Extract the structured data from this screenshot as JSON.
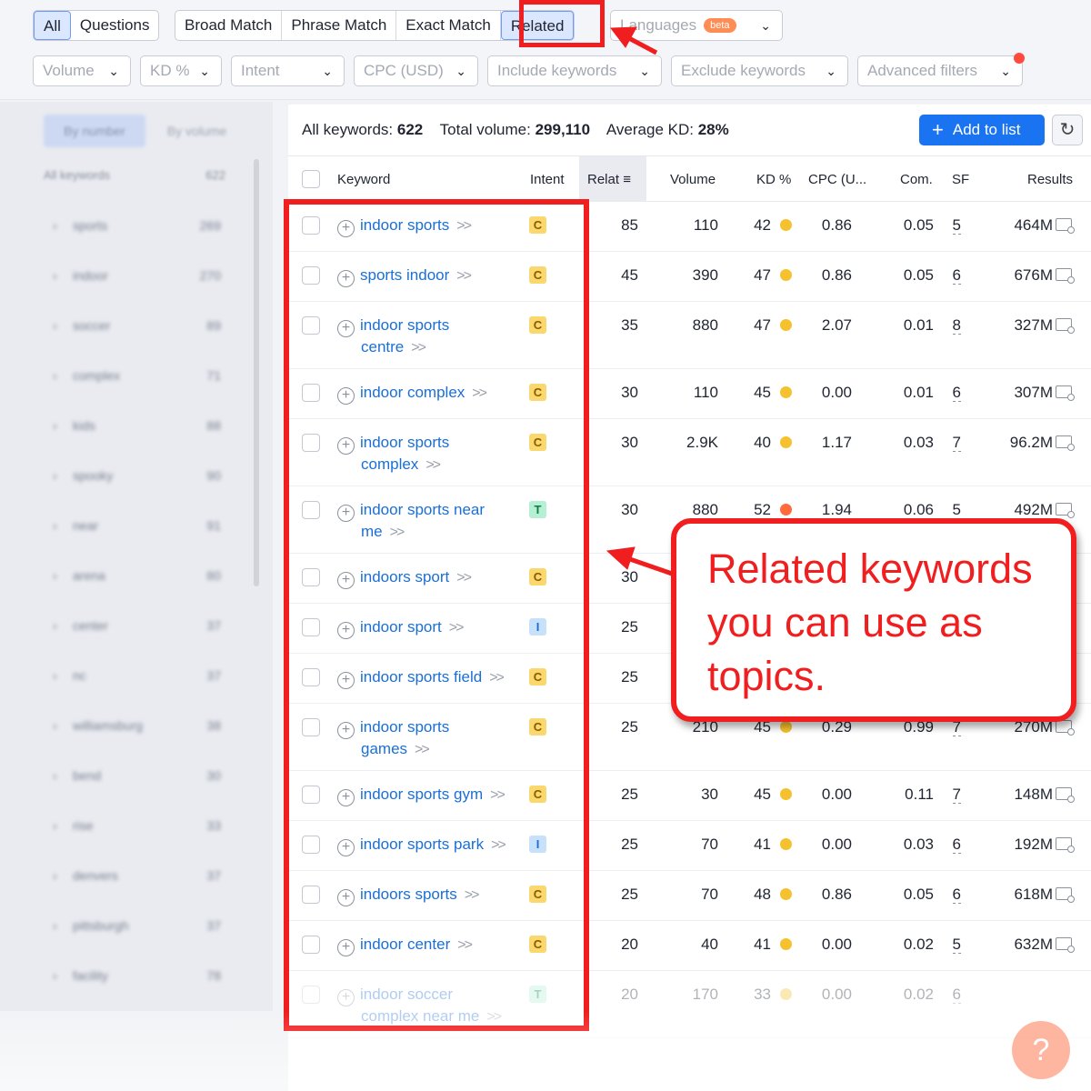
{
  "tabs": {
    "type_group": [
      "All",
      "Questions"
    ],
    "match_group": [
      "Broad Match",
      "Phrase Match",
      "Exact Match",
      "Related"
    ],
    "active_type": "All",
    "active_match": "Related"
  },
  "languages": {
    "label": "Languages",
    "badge": "beta"
  },
  "filters": [
    {
      "label": "Volume"
    },
    {
      "label": "KD %"
    },
    {
      "label": "Intent"
    },
    {
      "label": "CPC (USD)"
    },
    {
      "label": "Include keywords"
    },
    {
      "label": "Exclude keywords"
    },
    {
      "label": "Advanced filters"
    }
  ],
  "stats": {
    "all_keywords_label": "All keywords:",
    "all_keywords_value": "622",
    "total_volume_label": "Total volume:",
    "total_volume_value": "299,110",
    "avg_kd_label": "Average KD:",
    "avg_kd_value": "28%"
  },
  "actions": {
    "add_to_list": "Add to list"
  },
  "columns": {
    "keyword": "Keyword",
    "intent": "Intent",
    "related": "Relat",
    "volume": "Volume",
    "kd": "KD %",
    "cpc": "CPC (U...",
    "com": "Com.",
    "sf": "SF",
    "results": "Results"
  },
  "rows": [
    {
      "kw1": "indoor sports",
      "kw2": "",
      "intent": "C",
      "rel": "85",
      "vol": "110",
      "kd": "42",
      "kd_color": "#f5c12e",
      "cpc": "0.86",
      "com": "0.05",
      "sf": "5",
      "results": "464M"
    },
    {
      "kw1": "sports indoor",
      "kw2": "",
      "intent": "C",
      "rel": "45",
      "vol": "390",
      "kd": "47",
      "kd_color": "#f5c12e",
      "cpc": "0.86",
      "com": "0.05",
      "sf": "6",
      "results": "676M"
    },
    {
      "kw1": "indoor sports",
      "kw2": "centre",
      "intent": "C",
      "rel": "35",
      "vol": "880",
      "kd": "47",
      "kd_color": "#f5c12e",
      "cpc": "2.07",
      "com": "0.01",
      "sf": "8",
      "results": "327M"
    },
    {
      "kw1": "indoor complex",
      "kw2": "",
      "intent": "C",
      "rel": "30",
      "vol": "110",
      "kd": "45",
      "kd_color": "#f5c12e",
      "cpc": "0.00",
      "com": "0.01",
      "sf": "6",
      "results": "307M"
    },
    {
      "kw1": "indoor sports",
      "kw2": "complex",
      "intent": "C",
      "rel": "30",
      "vol": "2.9K",
      "kd": "40",
      "kd_color": "#f5c12e",
      "cpc": "1.17",
      "com": "0.03",
      "sf": "7",
      "results": "96.2M"
    },
    {
      "kw1": "indoor sports near",
      "kw2": "me",
      "intent": "T",
      "rel": "30",
      "vol": "880",
      "kd": "52",
      "kd_color": "#ff6b3d",
      "cpc": "1.94",
      "com": "0.06",
      "sf": "5",
      "results": "492M"
    },
    {
      "kw1": "indoors sport",
      "kw2": "",
      "intent": "C",
      "rel": "30",
      "vol": "",
      "kd": "",
      "kd_color": "",
      "cpc": "",
      "com": "",
      "sf": "",
      "results": ""
    },
    {
      "kw1": "indoor sport",
      "kw2": "",
      "intent": "I",
      "rel": "25",
      "vol": "",
      "kd": "",
      "kd_color": "",
      "cpc": "",
      "com": "",
      "sf": "",
      "results": ""
    },
    {
      "kw1": "indoor sports field",
      "kw2": "",
      "intent": "C",
      "rel": "25",
      "vol": "",
      "kd": "",
      "kd_color": "",
      "cpc": "",
      "com": "",
      "sf": "",
      "results": ""
    },
    {
      "kw1": "indoor sports",
      "kw2": "games",
      "intent": "C",
      "rel": "25",
      "vol": "210",
      "kd": "45",
      "kd_color": "#f5c12e",
      "cpc": "0.29",
      "com": "0.99",
      "sf": "7",
      "results": "270M"
    },
    {
      "kw1": "indoor sports gym",
      "kw2": "",
      "intent": "C",
      "rel": "25",
      "vol": "30",
      "kd": "45",
      "kd_color": "#f5c12e",
      "cpc": "0.00",
      "com": "0.11",
      "sf": "7",
      "results": "148M"
    },
    {
      "kw1": "indoor sports park",
      "kw2": "",
      "intent": "I",
      "rel": "25",
      "vol": "70",
      "kd": "41",
      "kd_color": "#f5c12e",
      "cpc": "0.00",
      "com": "0.03",
      "sf": "6",
      "results": "192M"
    },
    {
      "kw1": "indoors sports",
      "kw2": "",
      "intent": "C",
      "rel": "25",
      "vol": "70",
      "kd": "48",
      "kd_color": "#f5c12e",
      "cpc": "0.86",
      "com": "0.05",
      "sf": "6",
      "results": "618M"
    },
    {
      "kw1": "indoor center",
      "kw2": "",
      "intent": "C",
      "rel": "20",
      "vol": "40",
      "kd": "41",
      "kd_color": "#f5c12e",
      "cpc": "0.00",
      "com": "0.02",
      "sf": "5",
      "results": "632M"
    },
    {
      "kw1": "indoor soccer",
      "kw2": "complex near me",
      "intent": "T",
      "rel": "20",
      "vol": "170",
      "kd": "33",
      "kd_color": "#f5c12e",
      "cpc": "0.00",
      "com": "0.02",
      "sf": "6",
      "results": ""
    }
  ],
  "callout": {
    "text": "Related keywords you can use as topics."
  },
  "help": {
    "label": "?"
  },
  "sidebar": {
    "toggle": [
      "By number",
      "By volume"
    ],
    "header": [
      "All keywords",
      "622"
    ],
    "items": [
      {
        "k": "sports",
        "n": "269"
      },
      {
        "k": "indoor",
        "n": "270"
      },
      {
        "k": "soccer",
        "n": "89"
      },
      {
        "k": "complex",
        "n": "71"
      },
      {
        "k": "kids",
        "n": "88"
      },
      {
        "k": "spooky",
        "n": "90"
      },
      {
        "k": "near",
        "n": "91"
      },
      {
        "k": "arena",
        "n": "80"
      },
      {
        "k": "center",
        "n": "37"
      },
      {
        "k": "nc",
        "n": "37"
      },
      {
        "k": "williamsburg",
        "n": "38"
      },
      {
        "k": "bend",
        "n": "30"
      },
      {
        "k": "rise",
        "n": "33"
      },
      {
        "k": "denvers",
        "n": "37"
      },
      {
        "k": "pittsburgh",
        "n": "37"
      },
      {
        "k": "facility",
        "n": "78"
      }
    ]
  },
  "colors": {
    "accent": "#1a73f0",
    "highlight": "#f01e1e",
    "link": "#1a6fd6"
  }
}
